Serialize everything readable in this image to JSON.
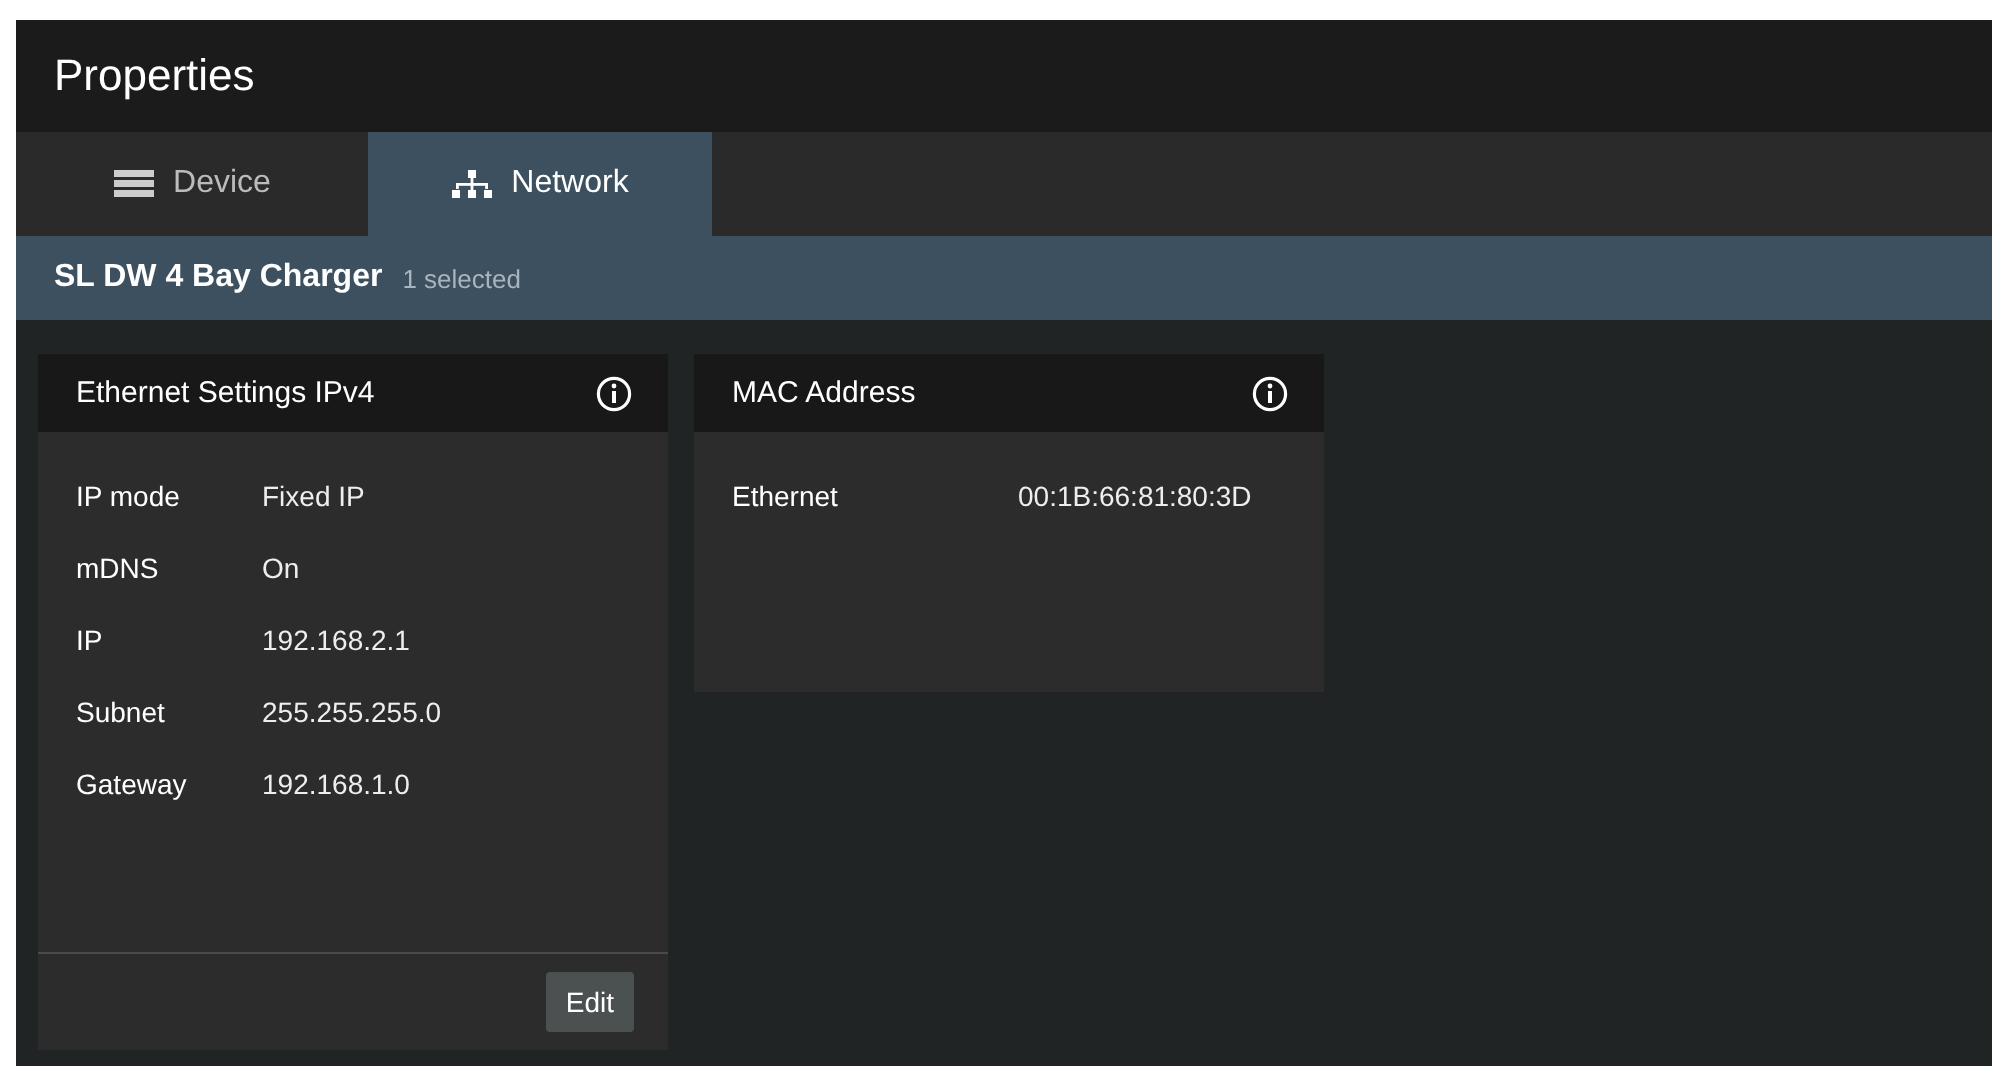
{
  "window": {
    "title": "Properties"
  },
  "tabs": [
    {
      "label": "Device",
      "selected": false
    },
    {
      "label": "Network",
      "selected": true
    }
  ],
  "subheader": {
    "device": "SL DW 4 Bay Charger",
    "count": "1 selected"
  },
  "cards": [
    {
      "title": "Ethernet Settings IPv4",
      "rows": [
        {
          "label": "IP mode",
          "value": "Fixed IP"
        },
        {
          "label": "mDNS",
          "value": "On"
        },
        {
          "label": "IP",
          "value": "192.168.2.1"
        },
        {
          "label": "Subnet",
          "value": "255.255.255.0"
        },
        {
          "label": "Gateway",
          "value": "192.168.1.0"
        }
      ],
      "button": "Edit"
    },
    {
      "title": "MAC Address",
      "rows": [
        {
          "label": "Ethernet",
          "value": "00:1B:66:81:80:3D"
        }
      ]
    }
  ]
}
